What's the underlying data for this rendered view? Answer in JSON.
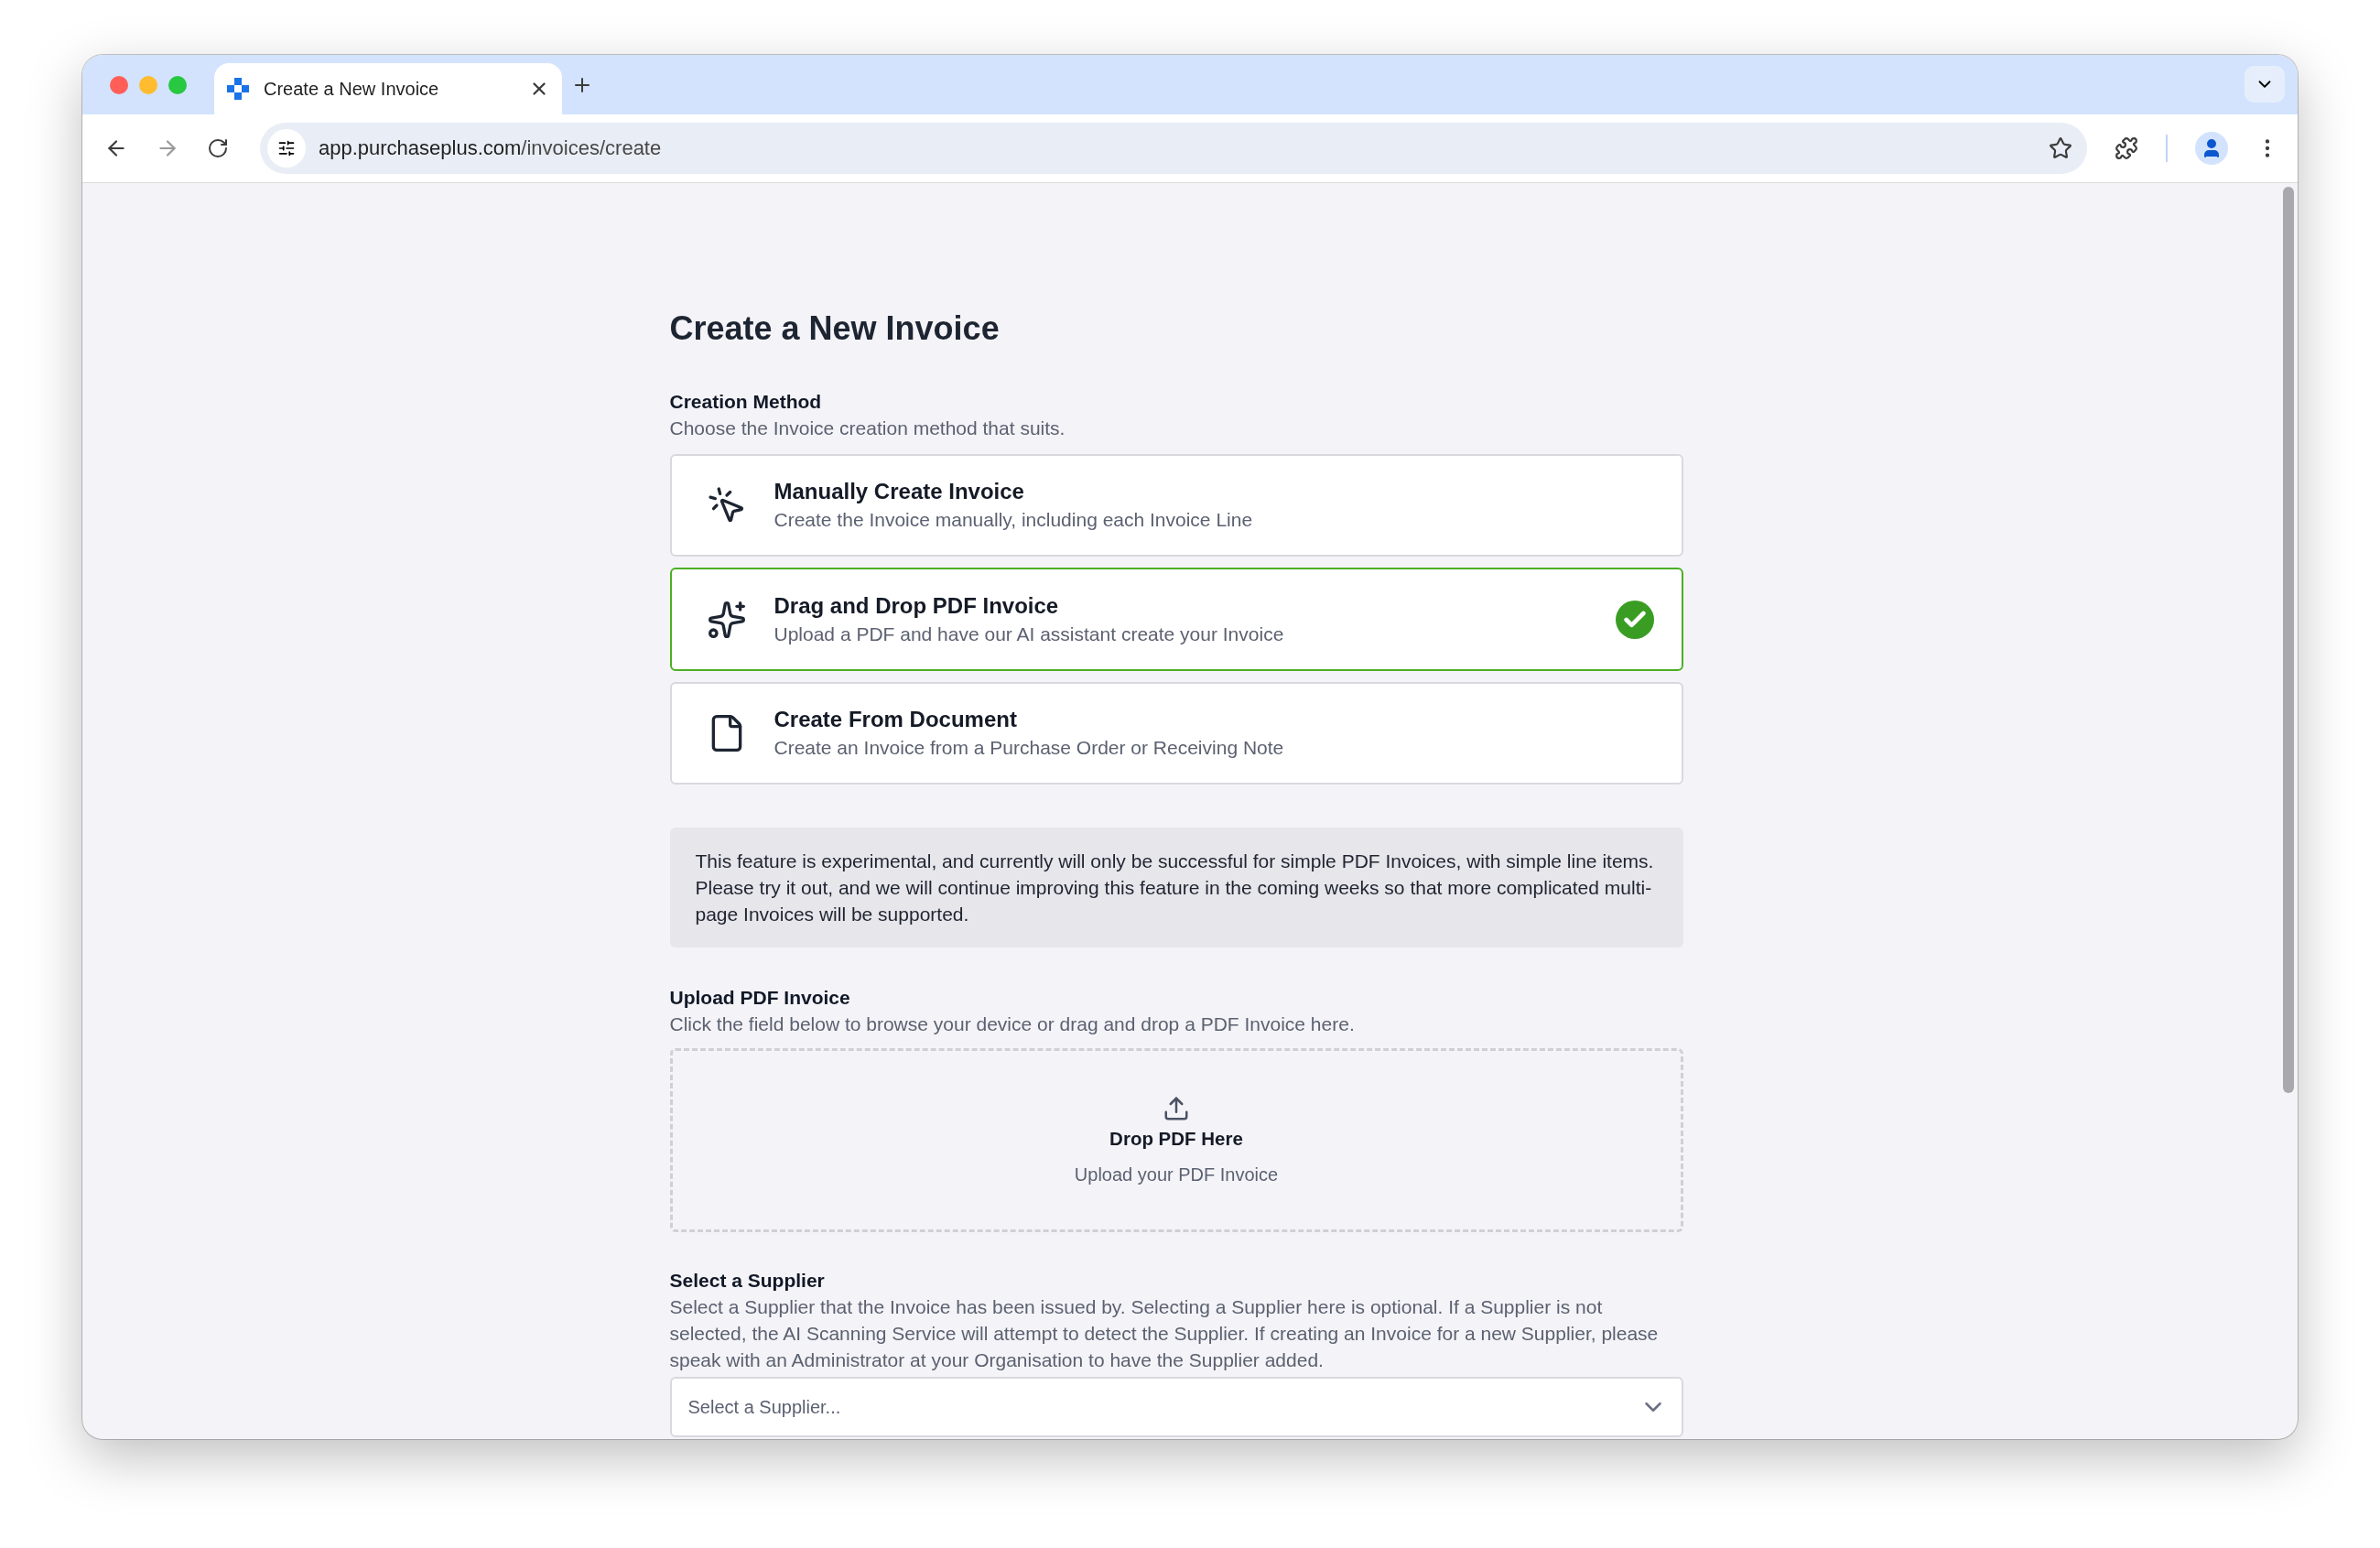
{
  "browser": {
    "tabs": [
      {
        "title": "Create a New Invoice",
        "selected": true
      }
    ],
    "url_host": "app.purchaseplus.com",
    "url_path": "/invoices/create"
  },
  "page": {
    "title": "Create a New Invoice",
    "creation_method": {
      "label": "Creation Method",
      "description": "Choose the Invoice creation method that suits.",
      "options": [
        {
          "kind": "manual",
          "title": "Manually Create Invoice",
          "description": "Create the Invoice manually, including each Invoice Line",
          "selected": false
        },
        {
          "kind": "pdf",
          "title": "Drag and Drop PDF Invoice",
          "description": "Upload a PDF and have our AI assistant create your Invoice",
          "selected": true
        },
        {
          "kind": "document",
          "title": "Create From Document",
          "description": "Create an Invoice from a Purchase Order or Receiving Note",
          "selected": false
        }
      ]
    },
    "notice": "This feature is experimental, and currently will only be successful for simple PDF Invoices, with simple line items. Please try it out, and we will continue improving this feature in the coming weeks so that more complicated multi-page Invoices will be supported.",
    "upload": {
      "label": "Upload PDF Invoice",
      "description": "Click the field below to browse your device or drag and drop a PDF Invoice here.",
      "drop_title": "Drop PDF Here",
      "drop_subtitle": "Upload your PDF Invoice"
    },
    "supplier": {
      "label": "Select a Supplier",
      "description": "Select a Supplier that the Invoice has been issued by. Selecting a Supplier here is optional. If a Supplier is not selected, the AI Scanning Service will attempt to detect the Supplier. If creating an Invoice for a new Supplier, please speak with an Administrator at your Organisation to have the Supplier added.",
      "placeholder": "Select a Supplier..."
    }
  }
}
